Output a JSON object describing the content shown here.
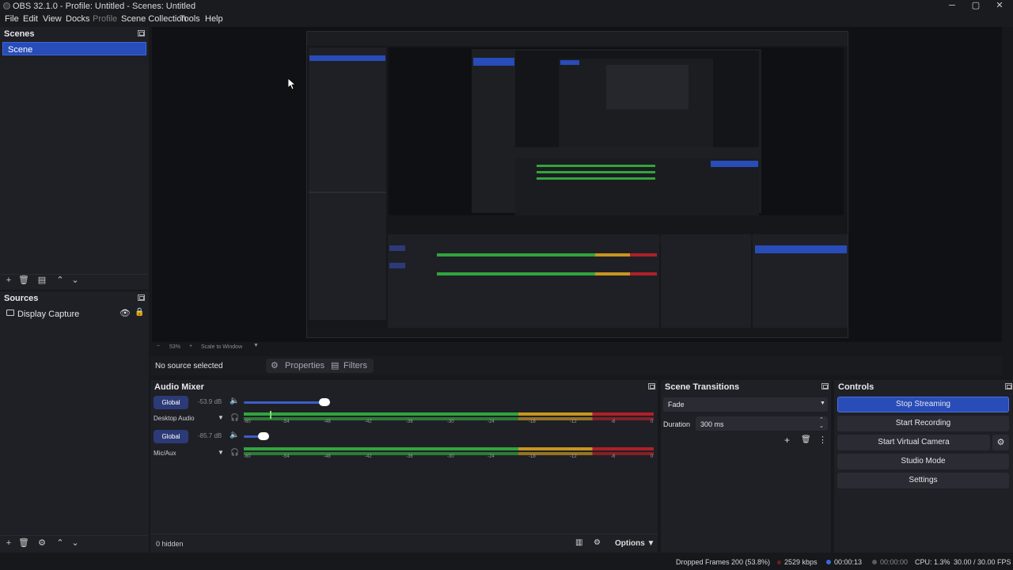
{
  "window": {
    "title": "OBS 32.1.0 - Profile: Untitled - Scenes: Untitled",
    "controls": [
      "─",
      "▢",
      "✕"
    ]
  },
  "menu": [
    "File",
    "Edit",
    "View",
    "Docks",
    "Profile",
    "Scene Collection",
    "Tools",
    "Help"
  ],
  "scenes": {
    "header": "Scenes",
    "items": [
      "Scene"
    ],
    "toolbar_icons": [
      "plus-icon",
      "trash-icon",
      "filter-icon",
      "chevron-up-icon",
      "chevron-down-icon"
    ]
  },
  "sources": {
    "header": "Sources",
    "items": [
      {
        "label": "Display Capture"
      }
    ],
    "toolbar_icons": [
      "plus-icon",
      "trash-icon",
      "gear-icon",
      "chevron-up-icon",
      "chevron-down-icon"
    ]
  },
  "preview": {
    "zoom": "53%",
    "scale_mode": "Scale to Window"
  },
  "source_bar": {
    "status": "No source selected",
    "properties": "Properties",
    "filters": "Filters"
  },
  "audio_mixer": {
    "header": "Audio Mixer",
    "tracks": [
      {
        "tag": "Global",
        "name": "Desktop Audio",
        "db": "-53.9 dB",
        "volume": 0.95
      },
      {
        "tag": "Global",
        "name": "Mic/Aux",
        "db": "-85.7 dB",
        "volume": 0.2
      }
    ],
    "scale": [
      "-60",
      "-54",
      "-48",
      "-42",
      "-36",
      "-30",
      "-24",
      "-18",
      "-12",
      "-6",
      "0"
    ],
    "hidden": "0 hidden",
    "options": "Options"
  },
  "transitions": {
    "header": "Scene Transitions",
    "selected": "Fade",
    "duration_label": "Duration",
    "duration_value": "300 ms"
  },
  "controls": {
    "header": "Controls",
    "stop_streaming": "Stop Streaming",
    "start_recording": "Start Recording",
    "start_virtual_camera": "Start Virtual Camera",
    "studio_mode": "Studio Mode",
    "settings": "Settings"
  },
  "status": {
    "dropped_frames": "Dropped Frames 200 (53.8%)",
    "bitrate": "2529 kbps",
    "stream_time": "00:00:13",
    "record_time": "00:00:00",
    "cpu": "CPU: 1.3%",
    "fps": "30.00 / 30.00 FPS"
  },
  "colors": {
    "accent": "#284cb8",
    "meter_green": "#32a43e",
    "meter_yellow": "#c7961f",
    "meter_red": "#b02028"
  }
}
